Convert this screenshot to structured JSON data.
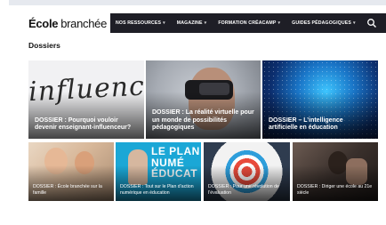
{
  "brand": {
    "part1": "École",
    "part2": "branchée"
  },
  "nav": {
    "items": [
      {
        "label": "NOS RESSOURCES",
        "chevron": "▾"
      },
      {
        "label": "MAGAZINE",
        "chevron": "▾"
      },
      {
        "label": "FORMATION CRÉACAMP",
        "chevron": "▾"
      },
      {
        "label": "GUIDES PÉDAGOGIQUES",
        "chevron": "▾"
      }
    ],
    "search_icon": "search-icon"
  },
  "page": {
    "title": "Dossiers"
  },
  "cards": {
    "featured": [
      {
        "title": "DOSSIER : Pourquoi vouloir devenir enseignant-influenceur?",
        "image_text": "influencer"
      },
      {
        "title": "DOSSIER : La réalité virtuelle pour un monde de possibilités pédagogiques"
      },
      {
        "title": "DOSSIER – L’intelligence artificielle en éducation"
      }
    ],
    "small": [
      {
        "title": "DOSSIER : École branchée sur la famille"
      },
      {
        "title": "DOSSIER : Tout sur le Plan d’action numérique en éducation",
        "image_text": "LE PLAN NUMÉ ÉDUCAT"
      },
      {
        "title": "DOSSIER : Pour une révolution de l’évaluation"
      },
      {
        "title": "DOSSIER : Diriger une école au 21e siècle"
      }
    ]
  },
  "colors": {
    "navbar": "#1e1e26",
    "accent": "#1ba7d6"
  }
}
